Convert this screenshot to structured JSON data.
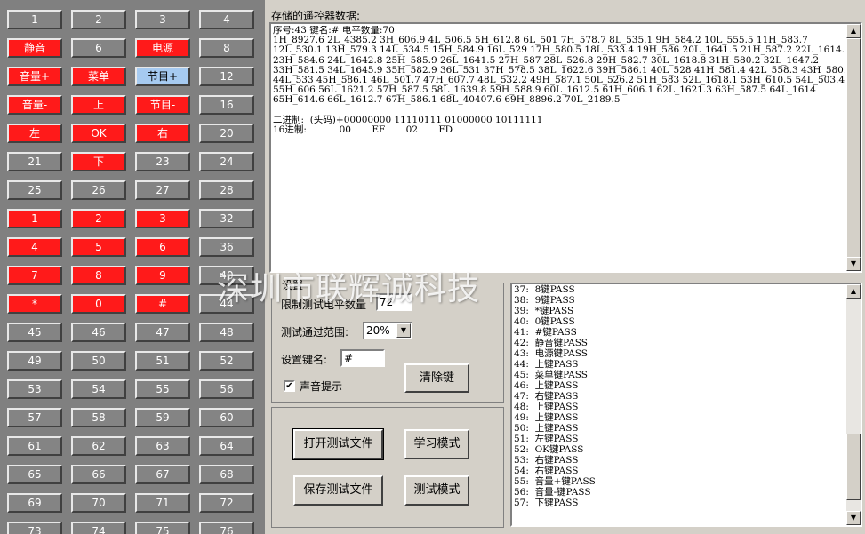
{
  "keys": [
    {
      "label": "1",
      "style": "gray"
    },
    {
      "label": "2",
      "style": "gray"
    },
    {
      "label": "3",
      "style": "gray"
    },
    {
      "label": "4",
      "style": "gray"
    },
    {
      "label": "静音",
      "style": "red"
    },
    {
      "label": "6",
      "style": "gray"
    },
    {
      "label": "电源",
      "style": "red"
    },
    {
      "label": "8",
      "style": "gray"
    },
    {
      "label": "音量+",
      "style": "red"
    },
    {
      "label": "菜单",
      "style": "red"
    },
    {
      "label": "节目+",
      "style": "light"
    },
    {
      "label": "12",
      "style": "gray"
    },
    {
      "label": "音量-",
      "style": "red"
    },
    {
      "label": "上",
      "style": "red"
    },
    {
      "label": "节目-",
      "style": "red"
    },
    {
      "label": "16",
      "style": "gray"
    },
    {
      "label": "左",
      "style": "red"
    },
    {
      "label": "OK",
      "style": "red"
    },
    {
      "label": "右",
      "style": "red"
    },
    {
      "label": "20",
      "style": "gray"
    },
    {
      "label": "21",
      "style": "gray"
    },
    {
      "label": "下",
      "style": "red"
    },
    {
      "label": "23",
      "style": "gray"
    },
    {
      "label": "24",
      "style": "gray"
    },
    {
      "label": "25",
      "style": "gray"
    },
    {
      "label": "26",
      "style": "gray"
    },
    {
      "label": "27",
      "style": "gray"
    },
    {
      "label": "28",
      "style": "gray"
    },
    {
      "label": "1",
      "style": "red"
    },
    {
      "label": "2",
      "style": "red"
    },
    {
      "label": "3",
      "style": "red"
    },
    {
      "label": "32",
      "style": "gray"
    },
    {
      "label": "4",
      "style": "red"
    },
    {
      "label": "5",
      "style": "red"
    },
    {
      "label": "6",
      "style": "red"
    },
    {
      "label": "36",
      "style": "gray"
    },
    {
      "label": "7",
      "style": "red"
    },
    {
      "label": "8",
      "style": "red"
    },
    {
      "label": "9",
      "style": "red"
    },
    {
      "label": "40",
      "style": "gray"
    },
    {
      "label": "*",
      "style": "red"
    },
    {
      "label": "0",
      "style": "red"
    },
    {
      "label": "#",
      "style": "red"
    },
    {
      "label": "44",
      "style": "gray"
    },
    {
      "label": "45",
      "style": "gray"
    },
    {
      "label": "46",
      "style": "gray"
    },
    {
      "label": "47",
      "style": "gray"
    },
    {
      "label": "48",
      "style": "gray"
    },
    {
      "label": "49",
      "style": "gray"
    },
    {
      "label": "50",
      "style": "gray"
    },
    {
      "label": "51",
      "style": "gray"
    },
    {
      "label": "52",
      "style": "gray"
    },
    {
      "label": "53",
      "style": "gray"
    },
    {
      "label": "54",
      "style": "gray"
    },
    {
      "label": "55",
      "style": "gray"
    },
    {
      "label": "56",
      "style": "gray"
    },
    {
      "label": "57",
      "style": "gray"
    },
    {
      "label": "58",
      "style": "gray"
    },
    {
      "label": "59",
      "style": "gray"
    },
    {
      "label": "60",
      "style": "gray"
    },
    {
      "label": "61",
      "style": "gray"
    },
    {
      "label": "62",
      "style": "gray"
    },
    {
      "label": "63",
      "style": "gray"
    },
    {
      "label": "64",
      "style": "gray"
    },
    {
      "label": "65",
      "style": "gray"
    },
    {
      "label": "66",
      "style": "gray"
    },
    {
      "label": "67",
      "style": "gray"
    },
    {
      "label": "68",
      "style": "gray"
    },
    {
      "label": "69",
      "style": "gray"
    },
    {
      "label": "70",
      "style": "gray"
    },
    {
      "label": "71",
      "style": "gray"
    },
    {
      "label": "72",
      "style": "gray"
    },
    {
      "label": "73",
      "style": "gray"
    },
    {
      "label": "74",
      "style": "gray"
    },
    {
      "label": "75",
      "style": "gray"
    },
    {
      "label": "76",
      "style": "gray"
    }
  ],
  "colors": {
    "key_gray": "#848484",
    "key_red": "#ff1a1a",
    "key_light": "#a6caf0",
    "panel": "#d4d0c8",
    "grid_bg": "#808080"
  },
  "data_panel": {
    "label": "存储的遥控器数据:",
    "text": "序号:43 键名:# 电平数量:70\n1H_8927.6 2L_4385.2 3H_606.9 4L_506.5 5H_612.8 6L_501 7H_578.7 8L_535.1 9H_584.2 10L_555.5 11H_583.7\n12L_530.1 13H_579.3 14L_534.5 15H_584.9 16L_529 17H_580.5 18L_533.4 19H_586 20L_1641.5 21H_587.2 22L_1614.3\n23H_584.6 24L_1642.8 25H_585.9 26L_1641.5 27H_587 28L_526.8 29H_582.7 30L_1618.8 31H_580.2 32L_1647.2\n33H_581.5 34L_1645.9 35H_582.9 36L_531 37H_578.5 38L_1622.6 39H_586.1 40L_528 41H_581.4 42L_558.3 43H_580.8\n44L_533 45H_586.1 46L_501.7 47H_607.7 48L_532.2 49H_587.1 50L_526.2 51H_583 52L_1618.1 53H_610.5 54L_503.4\n55H_606 56L_1621.2 57H_587.5 58L_1639.8 59H_588.9 60L_1612.5 61H_606.1 62L_1621.3 63H_587.5 64L_1614\n65H_614.6 66L_1612.7 67H_586.1 68L_40407.6 69H_8896.2 70L_2189.5\n\n二进制:  (头码)+00000000 11110111 01000000 10111111\n16进制:           00       EF       02       FD"
  },
  "settings": {
    "title": "设置",
    "level_label": "限制测试电平数量",
    "level_value": "72",
    "range_label": "测试通过范围:",
    "range_value": "20%",
    "keyname_label": "设置键名:",
    "keyname_value": "#",
    "clear_button": "清除键",
    "sound_label": "声音提示",
    "sound_checked": "✔"
  },
  "buttons": {
    "open_file": "打开测试文件",
    "learn_mode": "学习模式",
    "save_file": "保存测试文件",
    "test_mode": "测试模式"
  },
  "log": [
    "37:  8键PASS",
    "38:  9键PASS",
    "39:  *键PASS",
    "40:  0键PASS",
    "41:  #键PASS",
    "42:  静音键PASS",
    "43:  电源键PASS",
    "44:  上键PASS",
    "45:  菜单键PASS",
    "46:  上键PASS",
    "47:  右键PASS",
    "48:  上键PASS",
    "49:  上键PASS",
    "50:  上键PASS",
    "51:  左键PASS",
    "52:  OK键PASS",
    "53:  右键PASS",
    "54:  右键PASS",
    "55:  音量+键PASS",
    "56:  音量-键PASS",
    "57:  下键PASS"
  ],
  "watermark": "深圳市联辉诚科技",
  "icons": {
    "scroll_up": "▲",
    "scroll_down": "▼",
    "combo_arrow": "▼"
  }
}
